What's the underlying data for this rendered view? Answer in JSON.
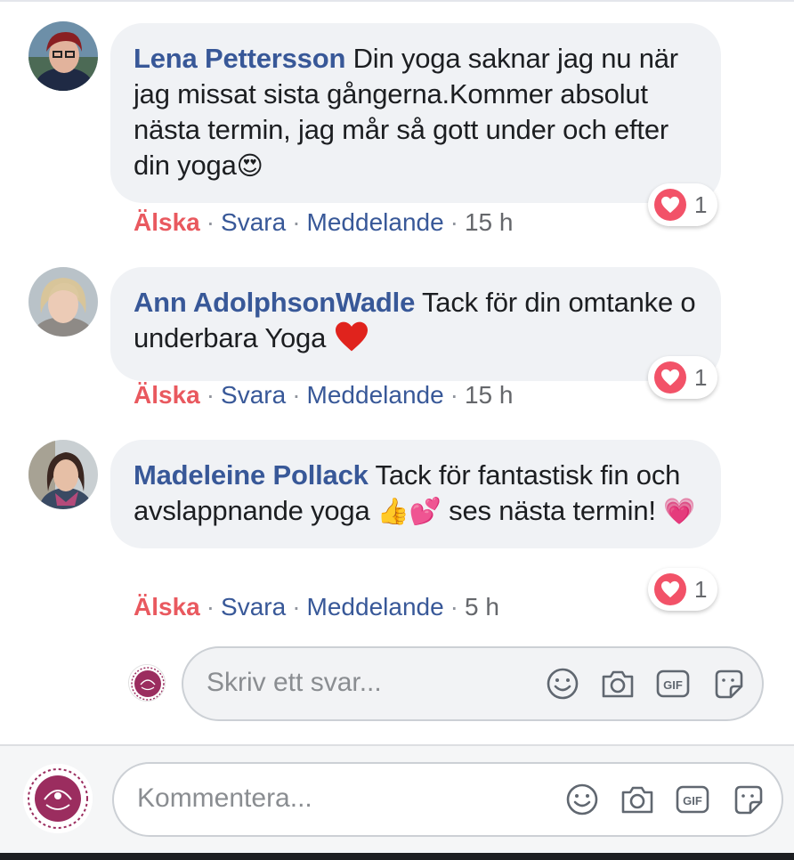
{
  "comments": [
    {
      "author": "Lena Pettersson",
      "text": "Din yoga saknar jag nu när jag missat sista gångerna.Kommer absolut nästa termin, jag mår så gott under och efter din yoga",
      "emoji": "😍",
      "reaction_count": "1",
      "actions": {
        "love": "Älska",
        "reply": "Svara",
        "message": "Meddelande",
        "time": "15 h"
      }
    },
    {
      "author": "Ann AdolphsonWadle",
      "text": "Tack för din omtanke o underbara Yoga",
      "emoji": "❤️",
      "reaction_count": "1",
      "actions": {
        "love": "Älska",
        "reply": "Svara",
        "message": "Meddelande",
        "time": "15 h"
      }
    },
    {
      "author": "Madeleine Pollack",
      "text_before": "Tack för fantastisk fin och avslappnande yoga",
      "emoji_1": "👍💕",
      "text_after": "ses nästa termin!",
      "emoji_2": "💗",
      "reaction_count": "1",
      "actions": {
        "love": "Älska",
        "reply": "Svara",
        "message": "Meddelande",
        "time": "5 h"
      }
    }
  ],
  "reply_box": {
    "placeholder": "Skriv ett svar..."
  },
  "comment_box": {
    "placeholder": "Kommentera..."
  },
  "icons": [
    "smiley-icon",
    "camera-icon",
    "gif-icon",
    "sticker-icon"
  ],
  "colors": {
    "author": "#385898",
    "love": "#e9595f",
    "heart": "#f25268",
    "bubble": "#f0f2f5"
  }
}
